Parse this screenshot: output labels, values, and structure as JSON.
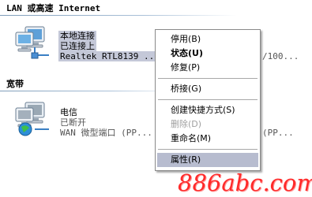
{
  "sections": {
    "lan_header": "LAN 或高速 Internet",
    "broadband_header": "宽带"
  },
  "lan_connection": {
    "name": "本地连接",
    "status": "已连接上",
    "device": "Realtek RTL8139 ...",
    "device_trailing": "/100..."
  },
  "wan_connection": {
    "name": "电信",
    "status": "已断开",
    "device": "WAN 微型端口 (PP...",
    "device_trailing": "(PP..."
  },
  "context_menu": {
    "items": [
      {
        "label": "停用(B)",
        "bold": false,
        "disabled": false
      },
      {
        "label": "状态(U)",
        "bold": true,
        "disabled": false
      },
      {
        "label": "修复(P)",
        "bold": false,
        "disabled": false
      },
      {
        "label": "桥接(G)",
        "bold": false,
        "disabled": false
      },
      {
        "label": "创建快捷方式(S)",
        "bold": false,
        "disabled": false
      },
      {
        "label": "删除(D)",
        "bold": false,
        "disabled": true
      },
      {
        "label": "重命名(M)",
        "bold": false,
        "disabled": false
      },
      {
        "label": "属性(R)",
        "bold": false,
        "disabled": false,
        "highlighted": true
      }
    ]
  },
  "watermark": "886abc.com",
  "icons": {
    "lan": "network-connection-icon",
    "wan": "broadband-connection-icon"
  },
  "colors": {
    "selection": "#c4c8d8",
    "menu_highlight": "#b7bccf",
    "watermark": "#ff2a2a"
  }
}
